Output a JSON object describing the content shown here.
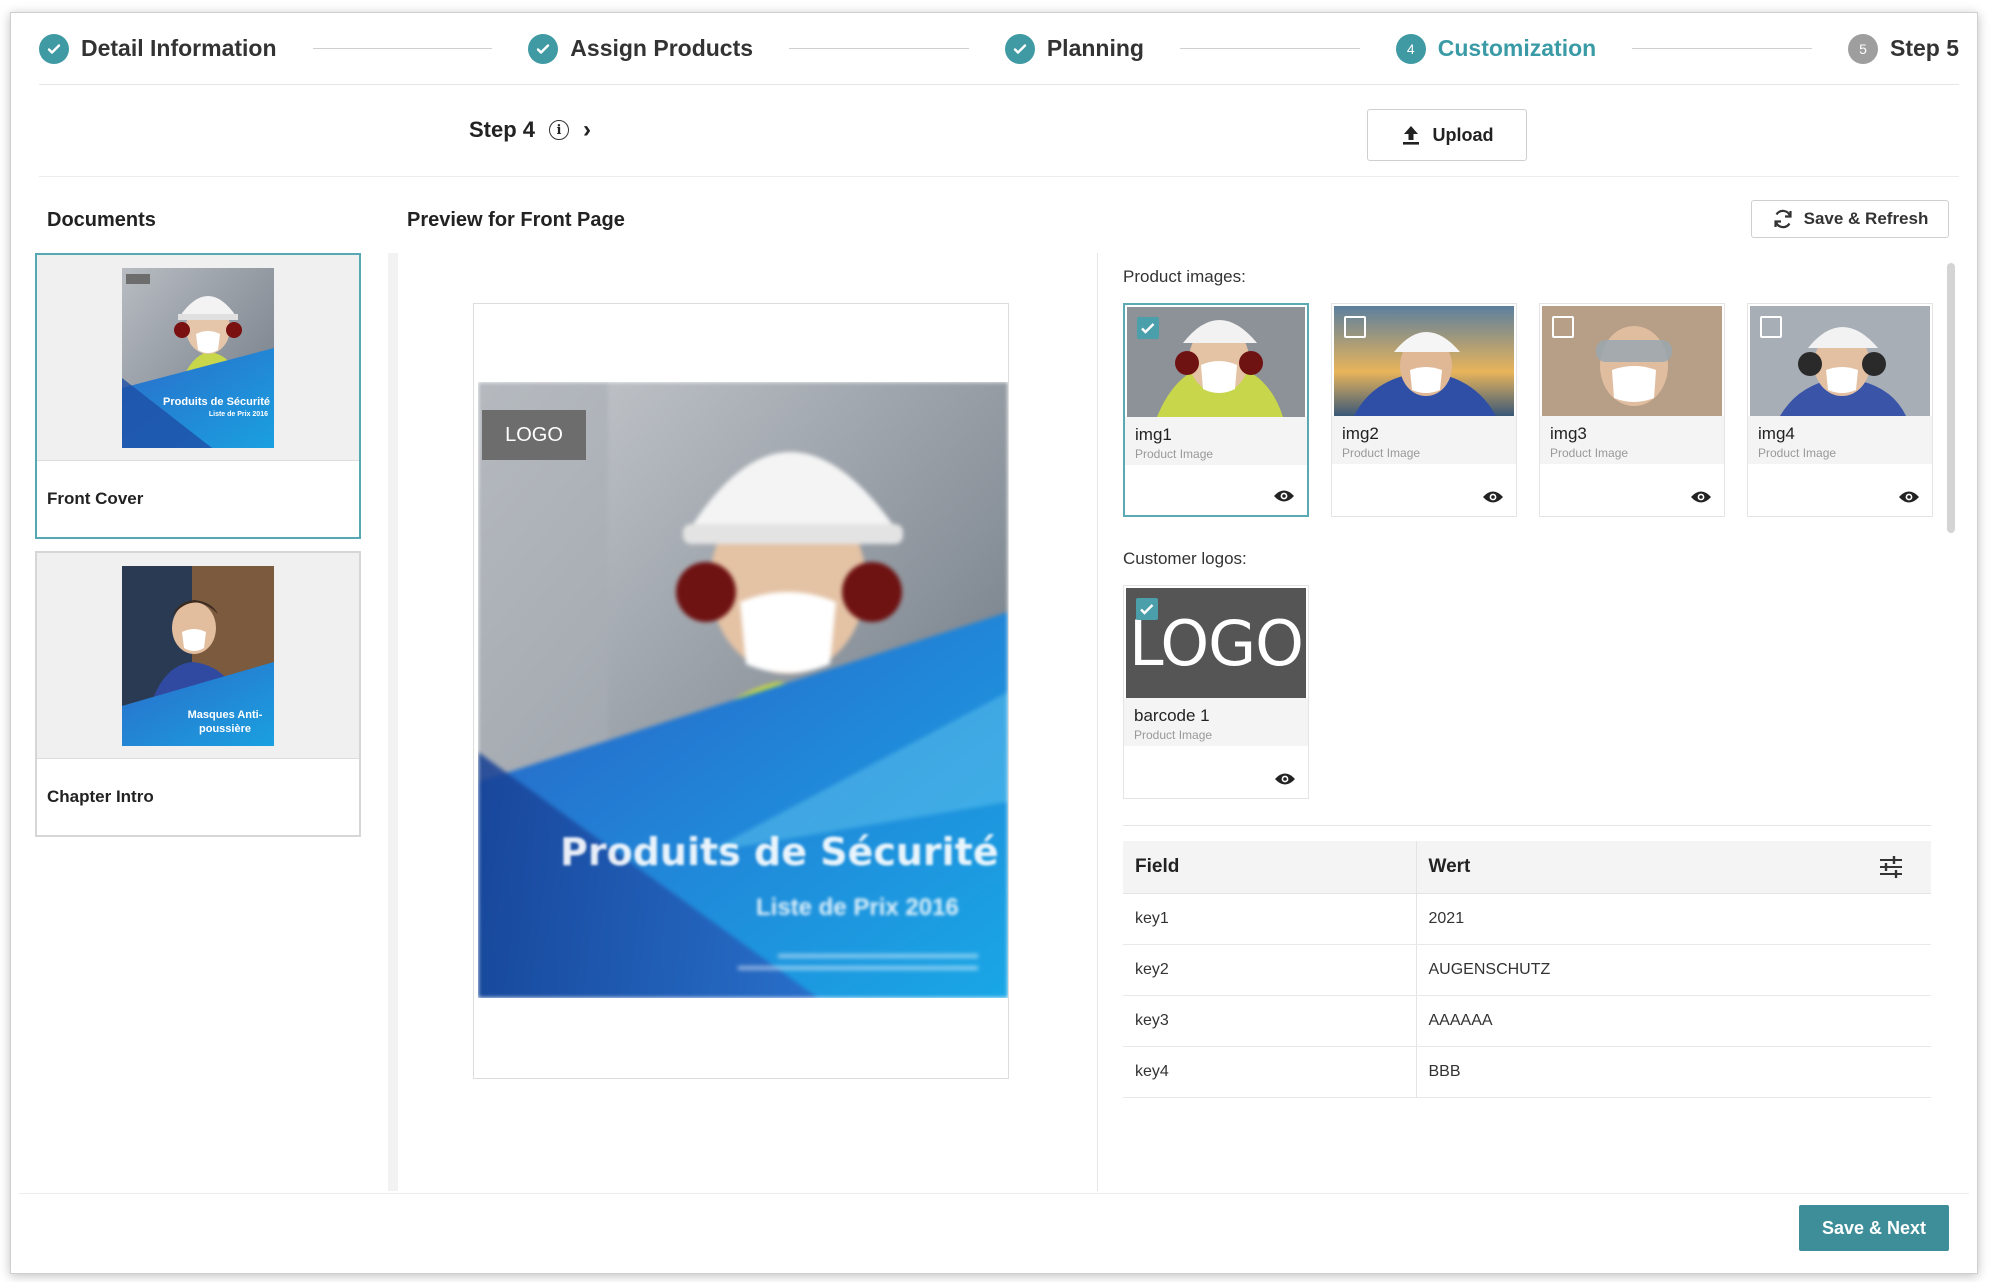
{
  "stepper": {
    "steps": [
      {
        "label": "Detail Information",
        "status": "done"
      },
      {
        "label": "Assign Products",
        "status": "done"
      },
      {
        "label": "Planning",
        "status": "done"
      },
      {
        "label": "Customization",
        "status": "active",
        "number": "4"
      },
      {
        "label": "Step 5",
        "status": "pending",
        "number": "5"
      }
    ]
  },
  "subheader": {
    "step_title": "Step 4",
    "upload_label": "Upload"
  },
  "documents": {
    "header": "Documents",
    "items": [
      {
        "label": "Front Cover",
        "thumb_title": "Produits de Sécurité",
        "thumb_sub": "Liste de Prix 2016",
        "selected": true
      },
      {
        "label": "Chapter Intro",
        "thumb_title": "Masques Anti-poussière",
        "selected": false
      }
    ]
  },
  "preview": {
    "header": "Preview for Front Page",
    "logo_text": "LOGO",
    "cover_title": "Produits de Sécurité",
    "cover_subtitle": "Liste de Prix 2016"
  },
  "toolbar": {
    "save_refresh_label": "Save & Refresh",
    "save_next_label": "Save & Next"
  },
  "product_images": {
    "label": "Product images:",
    "items": [
      {
        "name": "img1",
        "sub": "Product Image",
        "checked": true
      },
      {
        "name": "img2",
        "sub": "Product Image",
        "checked": false
      },
      {
        "name": "img3",
        "sub": "Product Image",
        "checked": false
      },
      {
        "name": "img4",
        "sub": "Product Image",
        "checked": false
      }
    ]
  },
  "customer_logos": {
    "label": "Customer logos:",
    "items": [
      {
        "name": "barcode 1",
        "sub": "Product Image",
        "logo_text": "LOGO",
        "checked": true
      }
    ]
  },
  "fields_table": {
    "headers": [
      "Field",
      "Wert"
    ],
    "rows": [
      {
        "field": "key1",
        "value": "2021"
      },
      {
        "field": "key2",
        "value": "AUGENSCHUTZ"
      },
      {
        "field": "key3",
        "value": "AAAAAA"
      },
      {
        "field": "key4",
        "value": "BBB"
      }
    ]
  },
  "colors": {
    "accent": "#3f9aa4",
    "primary_button": "#3d8e98",
    "pending_step": "#9e9e9e"
  }
}
